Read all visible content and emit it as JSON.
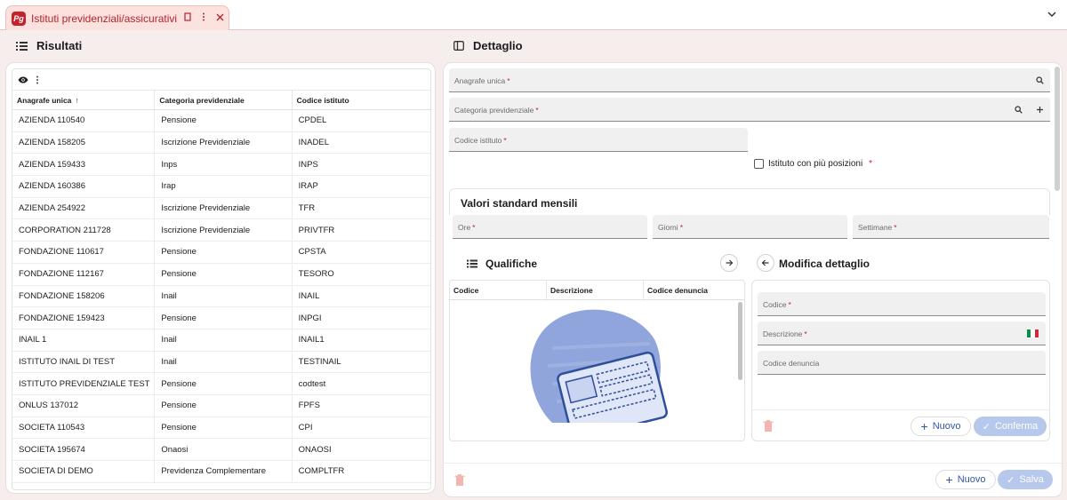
{
  "tab": {
    "logo": "Pg",
    "title": "Istituti previdenziali/assicurativi",
    "bookmark_icon": "bookmark-icon",
    "more_icon": "more-vert-icon",
    "close_icon": "close-icon",
    "expand_icon": "chevron-down-icon"
  },
  "left": {
    "title": "Risultati",
    "columns": [
      "Anagrafe unica",
      "Categoria previdenziale",
      "Codice istituto"
    ],
    "sort_indicator": "↑",
    "rows": [
      [
        "AZIENDA 110540",
        "Pensione",
        "CPDEL"
      ],
      [
        "AZIENDA 158205",
        "Iscrizione Previdenziale",
        "INADEL"
      ],
      [
        "AZIENDA 159433",
        "Inps",
        "INPS"
      ],
      [
        "AZIENDA 160386",
        "Irap",
        "IRAP"
      ],
      [
        "AZIENDA 254922",
        "Iscrizione Previdenziale",
        "TFR"
      ],
      [
        "CORPORATION 211728",
        "Iscrizione Previdenziale",
        "PRIVTFR"
      ],
      [
        "FONDAZIONE 110617",
        "Pensione",
        "CPSTA"
      ],
      [
        "FONDAZIONE 112167",
        "Pensione",
        "TESORO"
      ],
      [
        "FONDAZIONE 158206",
        "Inail",
        "INAIL"
      ],
      [
        "FONDAZIONE 159423",
        "Pensione",
        "INPGI"
      ],
      [
        "INAIL 1",
        "Inail",
        "INAIL1"
      ],
      [
        "ISTITUTO INAIL DI TEST",
        "Inail",
        "TESTINAIL"
      ],
      [
        "ISTITUTO PREVIDENZIALE TEST",
        "Pensione",
        "codtest"
      ],
      [
        "ONLUS 137012",
        "Pensione",
        "FPFS"
      ],
      [
        "SOCIETA 110543",
        "Pensione",
        "CPI"
      ],
      [
        "SOCIETA 195674",
        "Onaosi",
        "ONAOSI"
      ],
      [
        "SOCIETA DI DEMO",
        "Previdenza Complementare",
        "COMPLTFR"
      ]
    ]
  },
  "right": {
    "title": "Dettaglio",
    "fields": {
      "anagrafe": "Anagrafe unica",
      "categoria": "Categoria previdenziale",
      "codice_istituto": "Codice istituto",
      "piu_posizioni": "Istituto con più posizioni"
    },
    "required_mark": "*",
    "vsm": {
      "title": "Valori standard mensili",
      "ore": "Ore",
      "giorni": "Giorni",
      "settimane": "Settimane"
    },
    "qualifiche": {
      "title": "Qualifiche",
      "columns": [
        "Codice",
        "Descrizione",
        "Codice denuncia"
      ]
    },
    "modifica": {
      "title": "Modifica dettaglio",
      "codice": "Codice",
      "descrizione": "Descrizione",
      "codice_denuncia": "Codice denuncia",
      "nuovo": "Nuovo",
      "conferma": "Conferma"
    },
    "footer": {
      "nuovo": "Nuovo",
      "salva": "Salva"
    }
  },
  "colors": {
    "accent": "#c4222c",
    "primary": "#3555a8",
    "disabled_btn": "#b6c8ec"
  }
}
